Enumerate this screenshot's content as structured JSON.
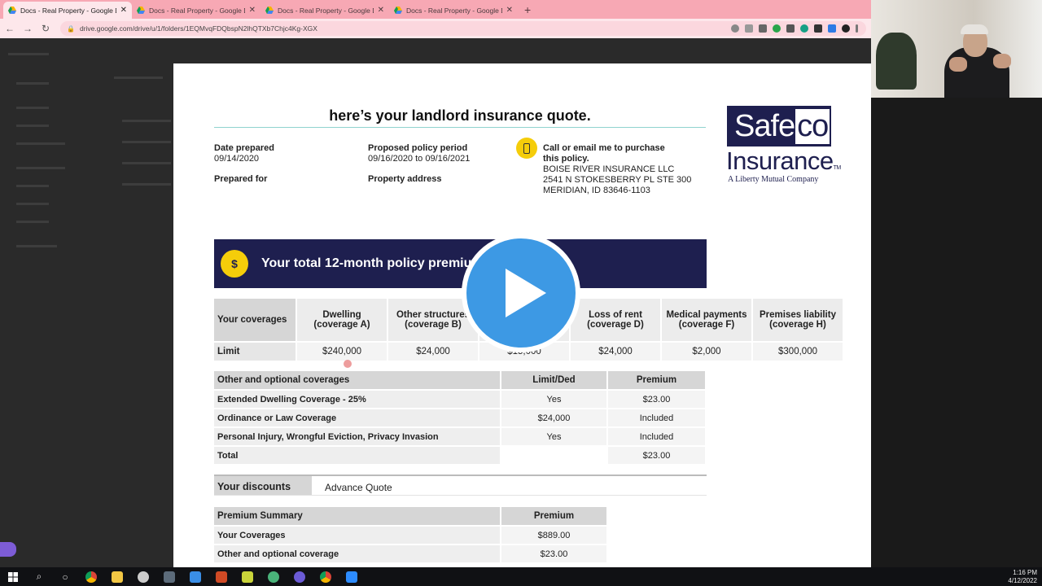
{
  "browser": {
    "tabs": [
      {
        "label": "Docs - Real Property - Google D",
        "active": true
      },
      {
        "label": "Docs - Real Property - Google D",
        "active": false
      },
      {
        "label": "Docs - Real Property - Google D",
        "active": false
      },
      {
        "label": "Docs - Real Property - Google D",
        "active": false
      }
    ],
    "url": "drive.google.com/drive/u/1/folders/1EQMvqFDQbspN2lhQTXb7Chjc4Kg-XGX"
  },
  "doc": {
    "title": "here’s your landlord insurance quote.",
    "date_label": "Date prepared",
    "date_value": "09/14/2020",
    "prepared_for_label": "Prepared for",
    "period_label": "Proposed policy period",
    "period_value": "09/16/2020 to 09/16/2021",
    "address_label": "Property address",
    "contact_heading_1": "Call or email me to purchase",
    "contact_heading_2": "this policy.",
    "agency_name": "BOISE RIVER INSURANCE LLC",
    "agency_street": "2541 N STOKESBERRY PL STE 300",
    "agency_city": "MERIDIAN, ID  83646-1103",
    "premium_band_text": "Your total 12-month policy premiu",
    "logo": {
      "safe": "Safe",
      "co": "co",
      "insurance": "Insurance",
      "tm": "TM",
      "tagline": "A Liberty Mutual Company"
    }
  },
  "coverages": {
    "headers": [
      "Your coverages",
      "Dwelling (coverage A)",
      "Other structures (coverage B)",
      "",
      "Loss of rent (coverage D)",
      "Medical payments (coverage F)",
      "Premises liability (coverage H)"
    ],
    "row_label": "Limit",
    "values": [
      "$240,000",
      "$24,000",
      "$15,000",
      "$24,000",
      "$2,000",
      "$300,000"
    ]
  },
  "optional": {
    "headers": [
      "Other and optional coverages",
      "Limit/Ded",
      "Premium"
    ],
    "rows": [
      [
        "Extended Dwelling Coverage - 25%",
        "Yes",
        "$23.00"
      ],
      [
        "Ordinance or Law Coverage",
        "$24,000",
        "Included"
      ],
      [
        "Personal Injury, Wrongful Eviction, Privacy Invasion",
        "Yes",
        "Included"
      ],
      [
        "Total",
        "",
        "$23.00"
      ]
    ]
  },
  "discounts": {
    "label": "Your discounts",
    "value": "Advance Quote"
  },
  "summary": {
    "headers": [
      "Premium Summary",
      "Premium"
    ],
    "rows": [
      [
        "Your Coverages",
        "$889.00"
      ],
      [
        "Other and optional coverage",
        "$23.00"
      ]
    ]
  },
  "taskbar": {
    "time": "1:16 PM",
    "date": "4/12/2022"
  },
  "colors": {
    "navy": "#1e1f4f",
    "yellow": "#f5cd0a",
    "play_blue": "#3d99e4",
    "tab_pink": "#f7a8b4"
  }
}
